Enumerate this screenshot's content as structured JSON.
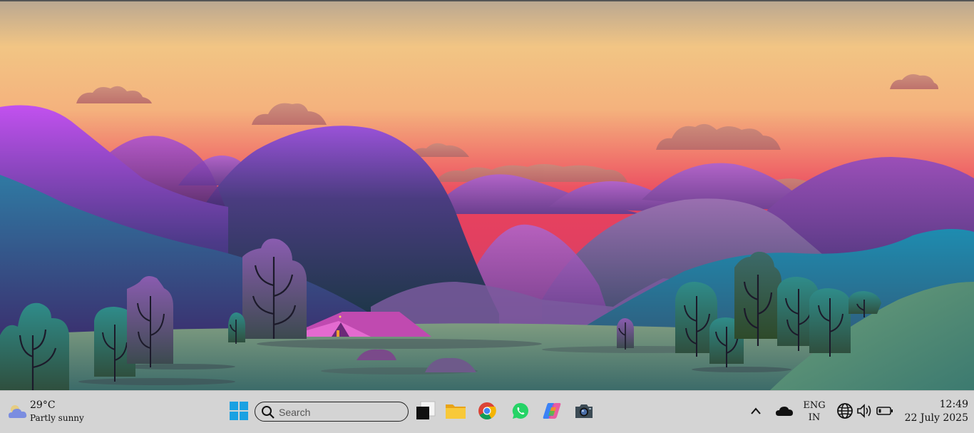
{
  "desktop": {
    "wallpaper": "sunset-valley-illustration"
  },
  "taskbar": {
    "weather": {
      "temperature": "29°C",
      "condition": "Partly sunny",
      "icon": "partly-cloudy-icon"
    },
    "start_icon": "windows-start-icon",
    "search": {
      "placeholder": "Search",
      "icon": "search-icon"
    },
    "pinned_apps": [
      {
        "name": "task-view",
        "icon": "task-view-icon"
      },
      {
        "name": "file-explorer",
        "icon": "folder-icon"
      },
      {
        "name": "chrome",
        "icon": "chrome-icon"
      },
      {
        "name": "whatsapp",
        "icon": "whatsapp-icon"
      },
      {
        "name": "copilot",
        "icon": "copilot-icon"
      },
      {
        "name": "camera",
        "icon": "camera-icon"
      }
    ],
    "tray": {
      "overflow_icon": "chevron-up-icon",
      "onedrive_icon": "cloud-icon",
      "language": {
        "line1": "ENG",
        "line2": "IN"
      },
      "network_icon": "globe-icon",
      "volume_icon": "speaker-icon",
      "battery_icon": "battery-icon"
    },
    "clock": {
      "time": "12:49",
      "date": "22 July 2025"
    }
  },
  "colors": {
    "taskbar_bg": "#d4d4d4",
    "start_blue": "#1ba1e2",
    "accent": "#0078d4"
  }
}
